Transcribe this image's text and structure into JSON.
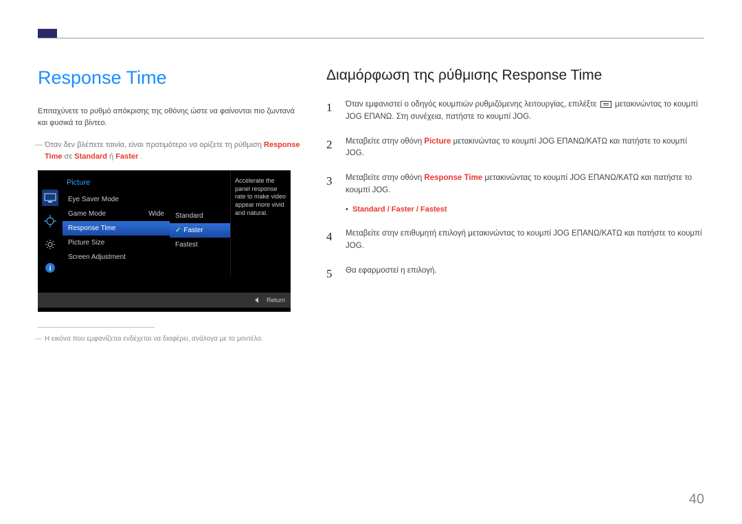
{
  "page_number": "40",
  "left": {
    "title": "Response Time",
    "desc": "Επιταχύνετε το ρυθμό απόκρισης της οθόνης ώστε να φαίνονται πιο ζωντανά και φυσικά τα βίντεο.",
    "note_prefix": "Όταν δεν βλέπετε ταινία, είναι προτιμότερο να ορίζετε τη ρύθμιση ",
    "note_label1": "Response Time",
    "note_mid": " σε ",
    "note_label2": "Standard",
    "note_or": " ή ",
    "note_label3": "Faster",
    "note_end": ".",
    "footnote": "Η εικόνα που εμφανίζεται ενδέχεται να διαφέρει, ανάλογα με το μοντέλο."
  },
  "osd": {
    "menu_title": "Picture",
    "items": [
      {
        "label": "Eye Saver Mode",
        "value": ""
      },
      {
        "label": "Game Mode",
        "value": "Wide"
      },
      {
        "label": "Response Time",
        "value": ""
      },
      {
        "label": "Picture Size",
        "value": ""
      },
      {
        "label": "Screen Adjustment",
        "value": ""
      }
    ],
    "sub_items": [
      "Standard",
      "Faster",
      "Fastest"
    ],
    "help": "Accelerate the panel response rate to make video appear more vivid and natural.",
    "return_label": "Return"
  },
  "right": {
    "title": "Διαμόρφωση της ρύθμισης Response Time",
    "step1_a": "Όταν εμφανιστεί ο οδηγός κουμπιών ρυθμιζόμενης λειτουργίας, επιλέξτε ",
    "step1_b": " μετακινώντας το κουμπί JOG ΕΠΑΝΩ. Στη συνέχεια, πατήστε το κουμπί JOG.",
    "step2_a": "Μεταβείτε στην οθόνη ",
    "step2_picture": "Picture",
    "step2_b": " μετακινώντας το κουμπί JOG ΕΠΑΝΩ/ΚΑΤΩ και πατήστε το κουμπί JOG.",
    "step3_a": "Μεταβείτε στην οθόνη ",
    "step3_rt": "Response Time",
    "step3_b": " μετακινώντας το κουμπί JOG ΕΠΑΝΩ/ΚΑΤΩ και πατήστε το κουμπί JOG.",
    "step3_bullet": "Standard / Faster / Fastest",
    "step4": "Μεταβείτε στην επιθυμητή επιλογή μετακινώντας το κουμπί JOG ΕΠΑΝΩ/ΚΑΤΩ και πατήστε το κουμπί JOG.",
    "step5": "Θα εφαρμοστεί η επιλογή."
  }
}
